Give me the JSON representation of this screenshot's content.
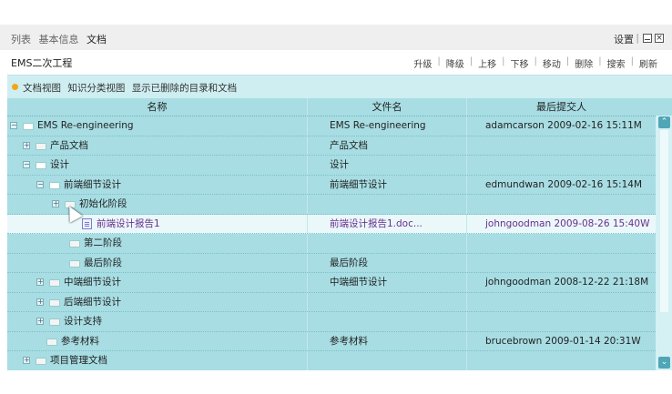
{
  "breadcrumb": [
    "列表",
    "基本信息",
    "文档"
  ],
  "header": {
    "settings_label": "设置",
    "min_icon": "minimize-icon",
    "close_icon": "close-icon",
    "close_glyph": "×"
  },
  "toolbar": {
    "project_name": "EMS二次工程",
    "actions": [
      "升级",
      "降级",
      "上移",
      "下移",
      "移动",
      "删除",
      "搜索",
      "刷新"
    ]
  },
  "viewbar": {
    "options": [
      "文档视图",
      "知识分类视图",
      "显示已删除的目录和文档"
    ]
  },
  "columns": [
    "名称",
    "文件名",
    "最后提交人"
  ],
  "rows": [
    {
      "name": "EMS Re-engineering",
      "file": "EMS Re-engineering",
      "submitter": "adamcarson 2009-02-16 15:11M",
      "toggle": "−",
      "icon": "folder-open-icon"
    },
    {
      "name": "产品文档",
      "file": "产品文档",
      "submitter": "",
      "toggle": "+",
      "icon": "folder-icon"
    },
    {
      "name": "设计",
      "file": "设计",
      "submitter": "",
      "toggle": "−",
      "icon": "folder-open-icon"
    },
    {
      "name": "前端细节设计",
      "file": "前端细节设计",
      "submitter": "edmundwan 2009-02-16 15:14M",
      "toggle": "−",
      "icon": "folder-open-icon"
    },
    {
      "name": "初始化阶段",
      "file": "",
      "submitter": "",
      "toggle": "+",
      "icon": "folder-icon"
    },
    {
      "name": "前端设计报告1",
      "file": "前端设计报告1.doc...",
      "submitter": "johngoodman 2009-08-26 15:40W",
      "toggle": "",
      "icon": "document-icon"
    },
    {
      "name": "第二阶段",
      "file": "",
      "submitter": "",
      "toggle": "",
      "icon": "folder-icon"
    },
    {
      "name": "最后阶段",
      "file": "最后阶段",
      "submitter": "",
      "toggle": "",
      "icon": "folder-icon"
    },
    {
      "name": "中端细节设计",
      "file": "中端细节设计",
      "submitter": "johngoodman 2008-12-22 21:18M",
      "toggle": "+",
      "icon": "folder-icon"
    },
    {
      "name": "后端细节设计",
      "file": "",
      "submitter": "",
      "toggle": "+",
      "icon": "folder-icon"
    },
    {
      "name": "设计支持",
      "file": "",
      "submitter": "",
      "toggle": "+",
      "icon": "folder-icon"
    },
    {
      "name": "参考材料",
      "file": "参考材料",
      "submitter": "brucebrown 2009-01-14 20:31W",
      "toggle": "",
      "icon": "folder-icon"
    },
    {
      "name": "项目管理文档",
      "file": "",
      "submitter": "",
      "toggle": "+",
      "icon": "folder-icon"
    }
  ],
  "scrollbar": {
    "up_icon": "scroll-up-icon",
    "down_icon": "scroll-down-icon",
    "up_glyph": "⌃",
    "down_glyph": "⌄"
  }
}
